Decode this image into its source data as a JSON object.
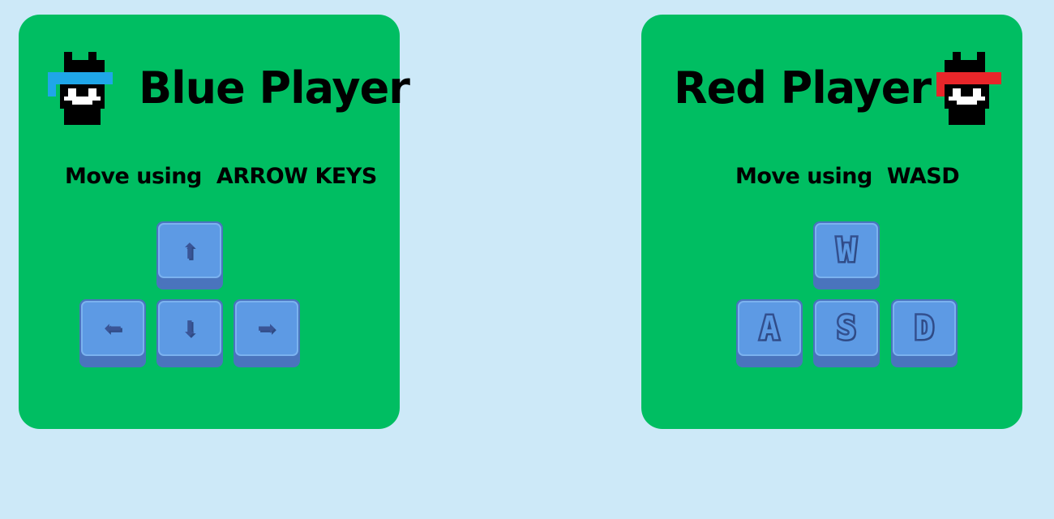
{
  "blue_player": {
    "title": "Blue Player",
    "instruction_prefix": "Move using",
    "instruction_keys": "ARROW KEYS",
    "bandana_color": "#1fa6e8",
    "keys": [
      {
        "name": "up-arrow-key",
        "icon": "arrow-up",
        "glyph": "⬆"
      },
      {
        "name": "left-arrow-key",
        "icon": "arrow-left",
        "glyph": "⬅"
      },
      {
        "name": "down-arrow-key",
        "icon": "arrow-down",
        "glyph": "⬇"
      },
      {
        "name": "right-arrow-key",
        "icon": "arrow-right",
        "glyph": "➡"
      }
    ]
  },
  "red_player": {
    "title": "Red Player",
    "instruction_prefix": "Move using",
    "instruction_keys": "WASD",
    "bandana_color": "#e8262a",
    "keys": [
      {
        "name": "w-key",
        "glyph": "W"
      },
      {
        "name": "a-key",
        "glyph": "A"
      },
      {
        "name": "s-key",
        "glyph": "S"
      },
      {
        "name": "d-key",
        "glyph": "D"
      }
    ]
  },
  "colors": {
    "background": "#cde9f8",
    "card": "#00be62",
    "key_face": "#5d9ae4",
    "key_shadow": "#4a74bd"
  }
}
